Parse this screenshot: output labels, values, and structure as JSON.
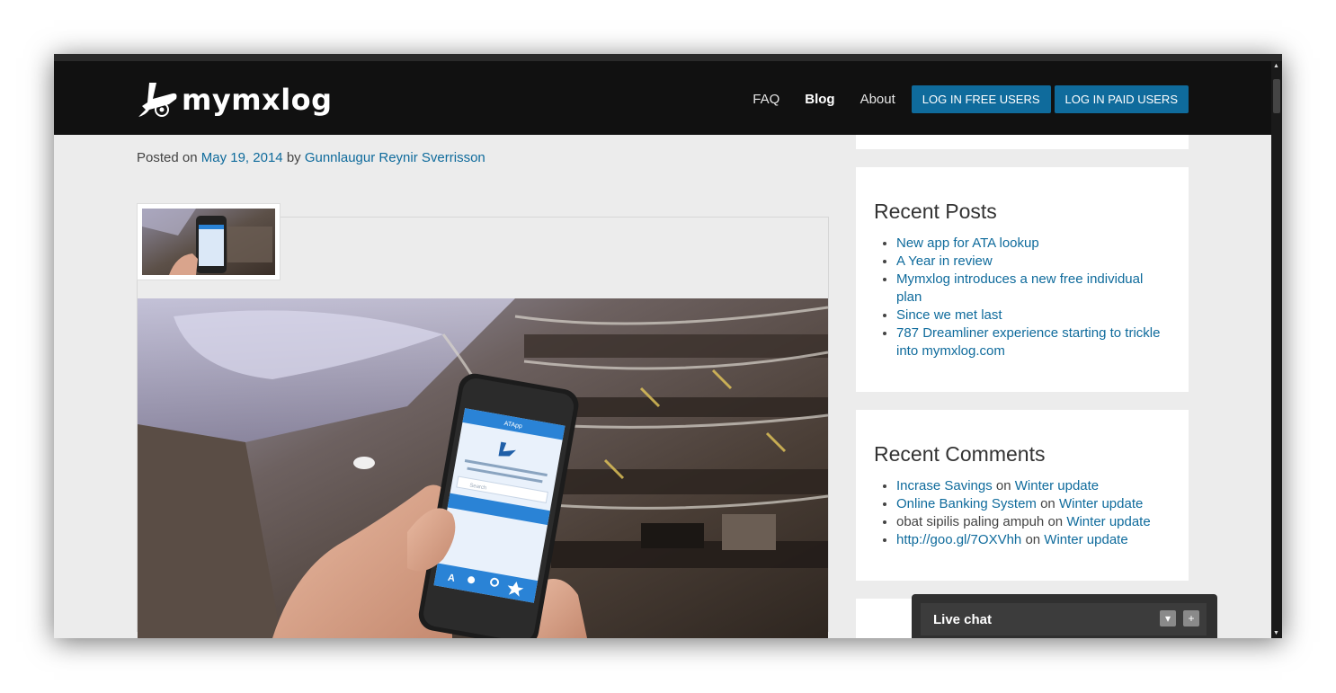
{
  "header": {
    "logo_text": "mymxlog",
    "nav": {
      "faq": "FAQ",
      "blog": "Blog",
      "about": "About",
      "login_free": "LOG IN FREE USERS",
      "login_paid": "LOG IN PAID USERS"
    }
  },
  "post": {
    "posted_on": "Posted on",
    "date": "May 19, 2014",
    "by": "by",
    "author": "Gunnlaugur Reynir Sverrisson"
  },
  "sidebar": {
    "recent_posts": {
      "title": "Recent Posts",
      "items": [
        "New app for ATA lookup",
        "A Year in review",
        "Mymxlog introduces a new free individual plan",
        "Since we met last",
        "787 Dreamliner experience starting to trickle into mymxlog.com"
      ]
    },
    "recent_comments": {
      "title": "Recent Comments",
      "on_word": "on",
      "items": [
        {
          "author": "Incrase Savings",
          "author_linked": true,
          "post": "Winter update"
        },
        {
          "author": "Online Banking System",
          "author_linked": true,
          "post": "Winter update"
        },
        {
          "author": "obat sipilis paling ampuh",
          "author_linked": false,
          "post": "Winter update"
        },
        {
          "author": "http://goo.gl/7OXVhh",
          "author_linked": true,
          "post": "Winter update"
        }
      ]
    }
  },
  "phone_screen": {
    "app_title": "ATApp",
    "search_placeholder": "Search"
  },
  "chat": {
    "title": "Live chat",
    "minimize": "▾",
    "expand": "+"
  },
  "colors": {
    "header_bg": "#111111",
    "accent": "#0f6b9c",
    "page_bg": "#ececec"
  }
}
